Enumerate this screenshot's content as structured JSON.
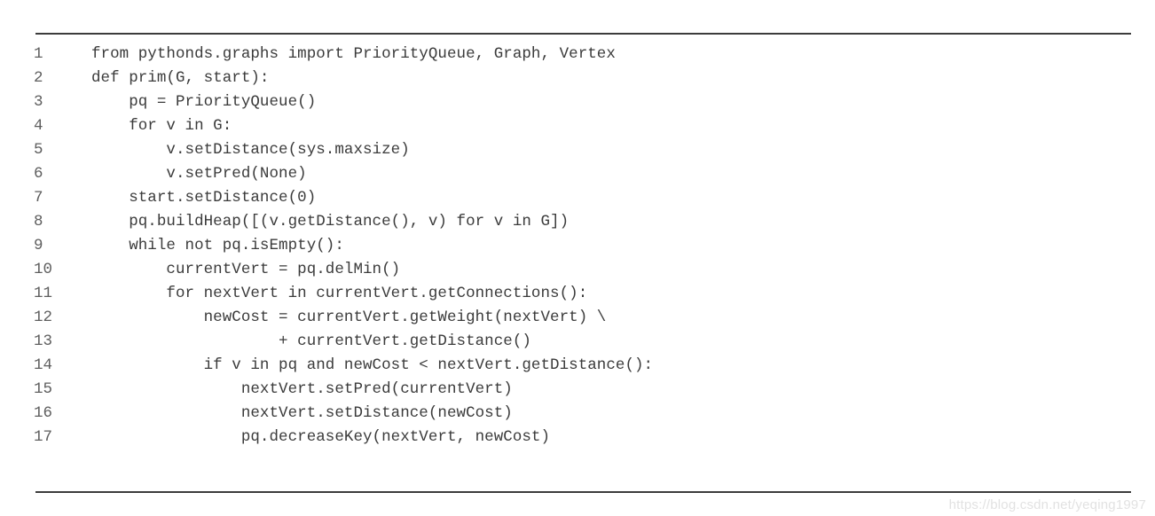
{
  "figure": {
    "kind": "code-listing",
    "language": "python",
    "background_color": "#ffffff",
    "rule_color": "#3c3c3c",
    "code_color": "#3b3b3b",
    "line_number_color": "#5e5e5e"
  },
  "code": {
    "lines": [
      {
        "number": "1",
        "text": "from pythonds.graphs import PriorityQueue, Graph, Vertex"
      },
      {
        "number": "2",
        "text": "def prim(G, start):"
      },
      {
        "number": "3",
        "text": "    pq = PriorityQueue()"
      },
      {
        "number": "4",
        "text": "    for v in G:"
      },
      {
        "number": "5",
        "text": "        v.setDistance(sys.maxsize)"
      },
      {
        "number": "6",
        "text": "        v.setPred(None)"
      },
      {
        "number": "7",
        "text": "    start.setDistance(0)"
      },
      {
        "number": "8",
        "text": "    pq.buildHeap([(v.getDistance(), v) for v in G])"
      },
      {
        "number": "9",
        "text": "    while not pq.isEmpty():"
      },
      {
        "number": "10",
        "text": "        currentVert = pq.delMin()"
      },
      {
        "number": "11",
        "text": "        for nextVert in currentVert.getConnections():"
      },
      {
        "number": "12",
        "text": "            newCost = currentVert.getWeight(nextVert) \\"
      },
      {
        "number": "13",
        "text": "                    + currentVert.getDistance()"
      },
      {
        "number": "14",
        "text": "            if v in pq and newCost < nextVert.getDistance():"
      },
      {
        "number": "15",
        "text": "                nextVert.setPred(currentVert)"
      },
      {
        "number": "16",
        "text": "                nextVert.setDistance(newCost)"
      },
      {
        "number": "17",
        "text": "                pq.decreaseKey(nextVert, newCost)"
      }
    ]
  },
  "watermark": {
    "text": "https://blog.csdn.net/yeqing1997"
  }
}
